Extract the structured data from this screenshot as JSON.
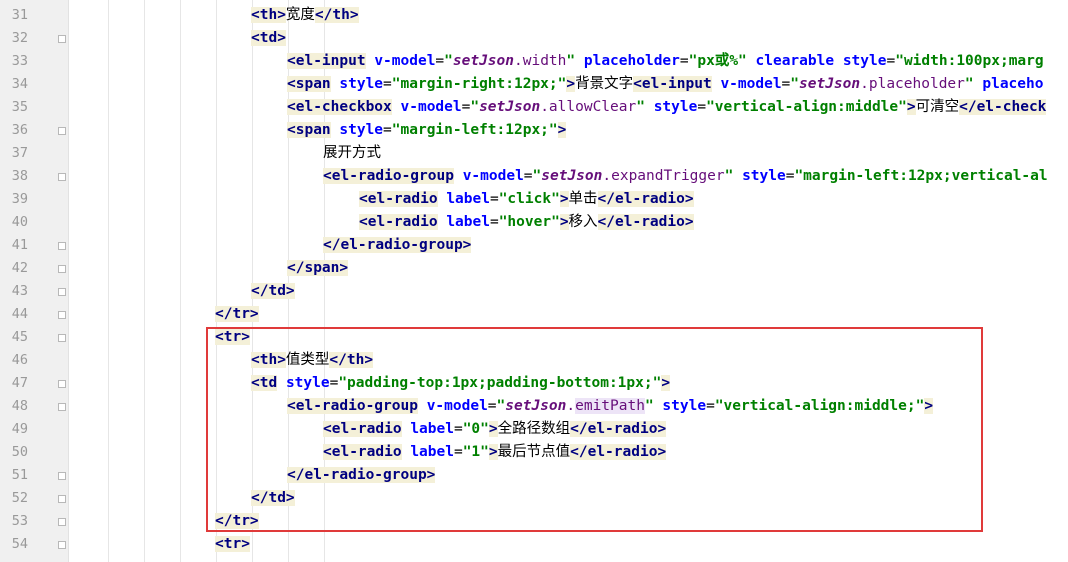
{
  "gutter": {
    "line_numbers": [
      "31",
      "32",
      "33",
      "34",
      "35",
      "36",
      "37",
      "38",
      "39",
      "40",
      "41",
      "42",
      "43",
      "44",
      "45",
      "46",
      "47",
      "48",
      "49",
      "50",
      "51",
      "52",
      "53",
      "54"
    ]
  },
  "code": {
    "l31": {
      "t1": "<th>",
      "x1": "宽度",
      "t2": "</th>"
    },
    "l32": {
      "t1": "<td>"
    },
    "l33": {
      "t1": "<el-input",
      "a1": "v-model",
      "e1": "=",
      "v1": "\"",
      "m1": "setJson",
      "p1": ".width",
      "v2": "\"",
      "a2": "placeholder",
      "e2": "=",
      "v3": "\"px或%\"",
      "a3": "clearable",
      "a4": "style",
      "e3": "=",
      "v4": "\"width:100px;marg"
    },
    "l34": {
      "t1": "<span",
      "a1": "style",
      "e1": "=",
      "v1": "\"margin-right:12px;\"",
      "t2": ">",
      "x1": "背景文字",
      "t3": "<el-input",
      "a2": "v-model",
      "e2": "=",
      "v2": "\"",
      "m1": "setJson",
      "p1": ".placeholder",
      "v3": "\"",
      "a3": "placeho"
    },
    "l35": {
      "t1": "<el-checkbox",
      "a1": "v-model",
      "e1": "=",
      "v1": "\"",
      "m1": "setJson",
      "p1": ".allowClear",
      "v2": "\"",
      "a2": "style",
      "e2": "=",
      "v3": "\"vertical-align:middle\"",
      "t2": ">",
      "x1": "可清空",
      "t3": "</el-check"
    },
    "l36": {
      "t1": "<span",
      "a1": "style",
      "e1": "=",
      "v1": "\"margin-left:12px;\"",
      "t2": ">"
    },
    "l37": {
      "x1": "展开方式"
    },
    "l38": {
      "t1": "<el-radio-group",
      "a1": "v-model",
      "e1": "=",
      "v1": "\"",
      "m1": "setJson",
      "p1": ".expandTrigger",
      "v2": "\"",
      "a2": "style",
      "e2": "=",
      "v3": "\"margin-left:12px;vertical-al"
    },
    "l39": {
      "t1": "<el-radio",
      "a1": "label",
      "e1": "=",
      "v1": "\"click\"",
      "t2": ">",
      "x1": "单击",
      "t3": "</el-radio>"
    },
    "l40": {
      "t1": "<el-radio",
      "a1": "label",
      "e1": "=",
      "v1": "\"hover\"",
      "t2": ">",
      "x1": "移入",
      "t3": "</el-radio>"
    },
    "l41": {
      "t1": "</el-radio-group>"
    },
    "l42": {
      "t1": "</span>"
    },
    "l43": {
      "t1": "</td>"
    },
    "l44": {
      "t1": "</tr>"
    },
    "l45": {
      "t1": "<tr>"
    },
    "l46": {
      "t1": "<th>",
      "x1": "值类型",
      "t2": "</th>"
    },
    "l47": {
      "t1": "<td",
      "a1": "style",
      "e1": "=",
      "v1": "\"padding-top:1px;padding-bottom:1px;\"",
      "t2": ">"
    },
    "l48": {
      "t1": "<el-radio-group",
      "a1": "v-model",
      "e1": "=",
      "v1": "\"",
      "m1": "setJson",
      "p1": ".",
      "p2": "emitPath",
      "v2": "\"",
      "a2": "style",
      "e2": "=",
      "v3": "\"vertical-align:middle;\"",
      "t2": ">"
    },
    "l49": {
      "t1": "<el-radio",
      "a1": "label",
      "e1": "=",
      "v1": "\"0\"",
      "t2": ">",
      "x1": "全路径数组",
      "t3": "</el-radio>"
    },
    "l50": {
      "t1": "<el-radio",
      "a1": "label",
      "e1": "=",
      "v1": "\"1\"",
      "t2": ">",
      "x1": "最后节点值",
      "t3": "</el-radio>"
    },
    "l51": {
      "t1": "</el-radio-group>"
    },
    "l52": {
      "t1": "</td>"
    },
    "l53": {
      "t1": "</tr>"
    },
    "l54": {
      "t1": "<tr>"
    }
  },
  "colors": {
    "tag_bg": "#f4f0d8",
    "tag": "#000080",
    "attr": "#0000ff",
    "value": "#008000",
    "model": "#660e7a",
    "highlight": "#e03a3a",
    "gutter_bg": "#f0f0f0"
  }
}
